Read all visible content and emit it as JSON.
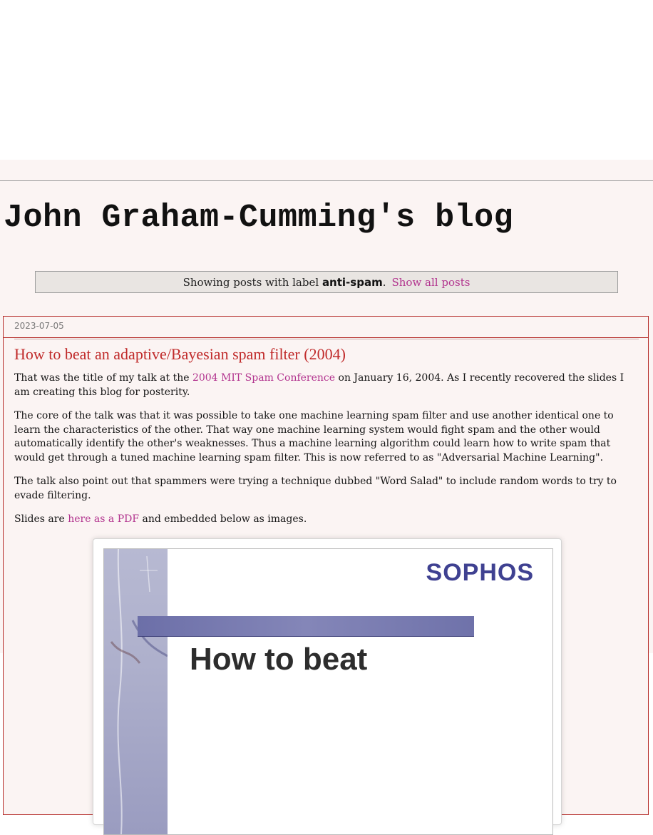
{
  "blog": {
    "title": "John Graham-Cumming's blog"
  },
  "status": {
    "prefix": "Showing posts with label",
    "label": "anti-spam",
    "suffix": ".",
    "show_all": "Show all posts"
  },
  "post": {
    "date": "2023-07-05",
    "title": "How to beat an adaptive/Bayesian spam filter (2004)",
    "p1": {
      "before": "That was the title of my talk at the ",
      "link": "2004 MIT Spam Conference",
      "after": " on January 16, 2004. As I recently recovered the slides I am creating this blog for posterity."
    },
    "p2": "The core of the talk was that it was possible to take one machine learning spam filter and use another identical one to learn the characteristics of the other. That way one machine learning system would fight spam and the other would automatically identify the other's weaknesses. Thus a machine learning algorithm could learn how to write spam that would get through a tuned machine learning spam filter. This is now referred to as \"Adversarial Machine Learning\".",
    "p3": "The talk also point out that spammers were trying a technique dubbed \"Word Salad\" to include random words to try to evade filtering.",
    "p4": {
      "before": "Slides are ",
      "link": "here as a PDF",
      "after": " and embedded below as images."
    }
  },
  "slide": {
    "logo": "SOPHOS",
    "heading": "How to beat"
  },
  "colors": {
    "page_bg": "#fbf4f3",
    "link": "#b2338e",
    "post_title": "#c02a2a",
    "post_border": "#b52b28",
    "sophos_blue": "#3f4191"
  }
}
